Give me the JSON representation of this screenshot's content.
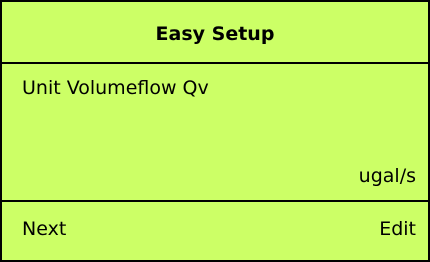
{
  "header": {
    "title": "Easy Setup"
  },
  "content": {
    "parameter_label": "Unit Volumeflow Qv",
    "selected_value": "ugal/s"
  },
  "softkeys": {
    "left_label": "Next",
    "right_label": "Edit"
  },
  "colors": {
    "display_background": "#ccff66",
    "text": "#000000",
    "divider": "#000000"
  }
}
